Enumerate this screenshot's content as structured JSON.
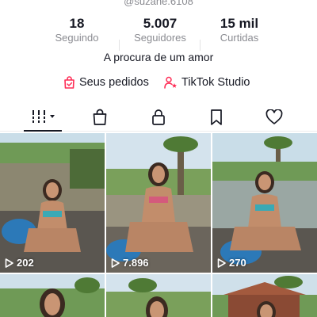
{
  "profile": {
    "handle": "@suzane.6108",
    "bio": "A procura de um amor"
  },
  "stats": [
    {
      "value": "18",
      "label": "Seguindo"
    },
    {
      "value": "5.007",
      "label": "Seguidores"
    },
    {
      "value": "15 mil",
      "label": "Curtidas"
    }
  ],
  "links": {
    "orders": "Seus pedidos",
    "studio": "TikTok Studio"
  },
  "tabs": [
    "videos-grid-icon",
    "shop-bag-icon",
    "lock-icon",
    "bookmark-icon",
    "heart-icon"
  ],
  "colors": {
    "accent": "#fe2c55",
    "text": "#161823",
    "muted": "#8a8b91"
  },
  "videos": [
    {
      "views": "202"
    },
    {
      "views": "7.896"
    },
    {
      "views": "270"
    },
    {
      "views": ""
    },
    {
      "views": ""
    },
    {
      "views": ""
    }
  ]
}
